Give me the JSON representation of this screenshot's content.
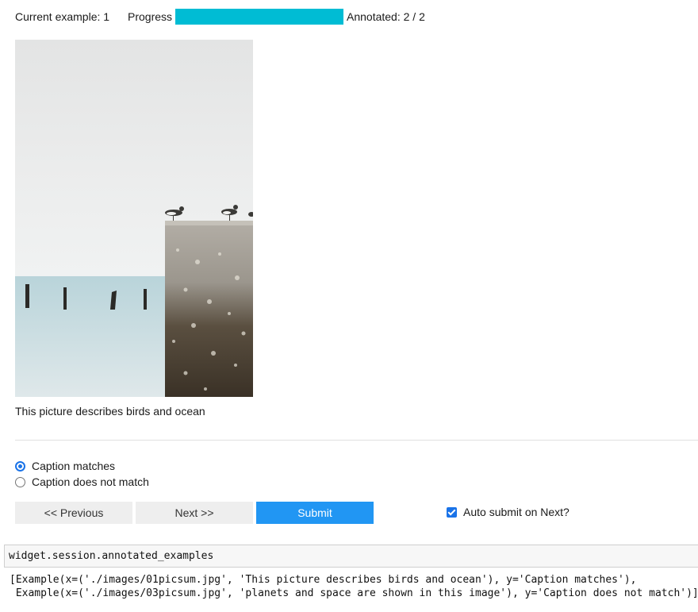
{
  "header": {
    "current_example_label": "Current example: 1",
    "progress_label": "Progress",
    "progress_fraction": 1.0,
    "annotated_label": "Annotated: 2 / 2",
    "progress_color": "#00bcd4"
  },
  "image": {
    "alt": "Seagulls on a concrete pier beside the ocean"
  },
  "caption": "This picture describes birds and ocean",
  "options": [
    {
      "label": "Caption matches",
      "selected": true
    },
    {
      "label": "Caption does not match",
      "selected": false
    }
  ],
  "buttons": {
    "previous": "<< Previous",
    "next": "Next >>",
    "submit": "Submit",
    "submit_color": "#2196f3"
  },
  "auto_submit": {
    "label": "Auto submit on Next?",
    "checked": true
  },
  "code_cell": {
    "source": "widget.session.annotated_examples"
  },
  "output": {
    "lines": [
      "[Example(x=('./images/01picsum.jpg', 'This picture describes birds and ocean'), y='Caption matches'),",
      " Example(x=('./images/03picsum.jpg', 'planets and space are shown in this image'), y='Caption does not match')]"
    ]
  }
}
